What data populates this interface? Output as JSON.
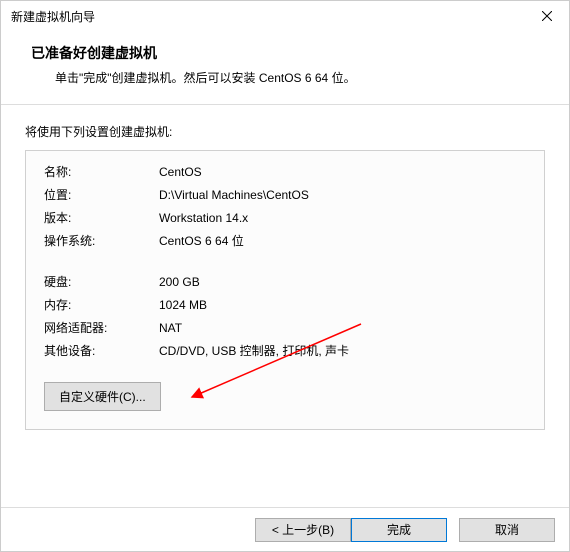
{
  "window": {
    "title": "新建虚拟机向导"
  },
  "header": {
    "title": "已准备好创建虚拟机",
    "description": "单击\"完成\"创建虚拟机。然后可以安装 CentOS 6 64 位。"
  },
  "section": {
    "label": "将使用下列设置创建虚拟机:"
  },
  "props": {
    "name_label": "名称:",
    "name_value": "CentOS",
    "location_label": "位置:",
    "location_value": "D:\\Virtual Machines\\CentOS",
    "version_label": "版本:",
    "version_value": "Workstation 14.x",
    "os_label": "操作系统:",
    "os_value": "CentOS 6 64 位",
    "disk_label": "硬盘:",
    "disk_value": "200 GB",
    "memory_label": "内存:",
    "memory_value": "1024 MB",
    "network_label": "网络适配器:",
    "network_value": "NAT",
    "other_label": "其他设备:",
    "other_value": "CD/DVD, USB 控制器, 打印机, 声卡"
  },
  "buttons": {
    "customize": "自定义硬件(C)...",
    "back": "< 上一步(B)",
    "finish": "完成",
    "cancel": "取消"
  }
}
